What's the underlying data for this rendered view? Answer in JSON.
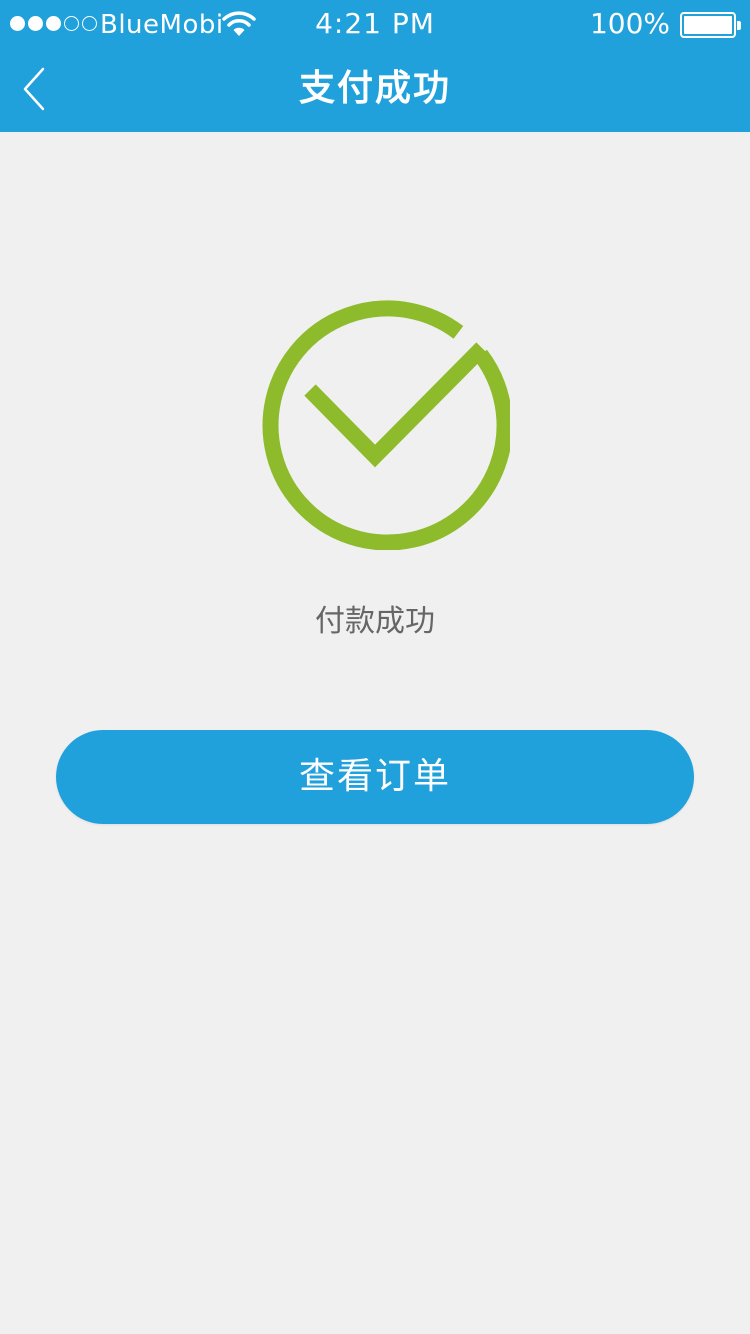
{
  "status_bar": {
    "carrier": "BlueMobi",
    "time": "4:21 PM",
    "battery_percent": "100%",
    "signal_bars_filled": 3,
    "signal_bars_total": 5
  },
  "nav": {
    "back_icon": "chevron-left-icon",
    "title": "支付成功"
  },
  "result": {
    "icon": "check-circle-icon",
    "message": "付款成功"
  },
  "actions": {
    "view_order_label": "查看订单"
  },
  "colors": {
    "primary": "#21a1dc",
    "success": "#8dbb2b",
    "background": "#f0f0f0",
    "text_secondary": "#666666"
  }
}
